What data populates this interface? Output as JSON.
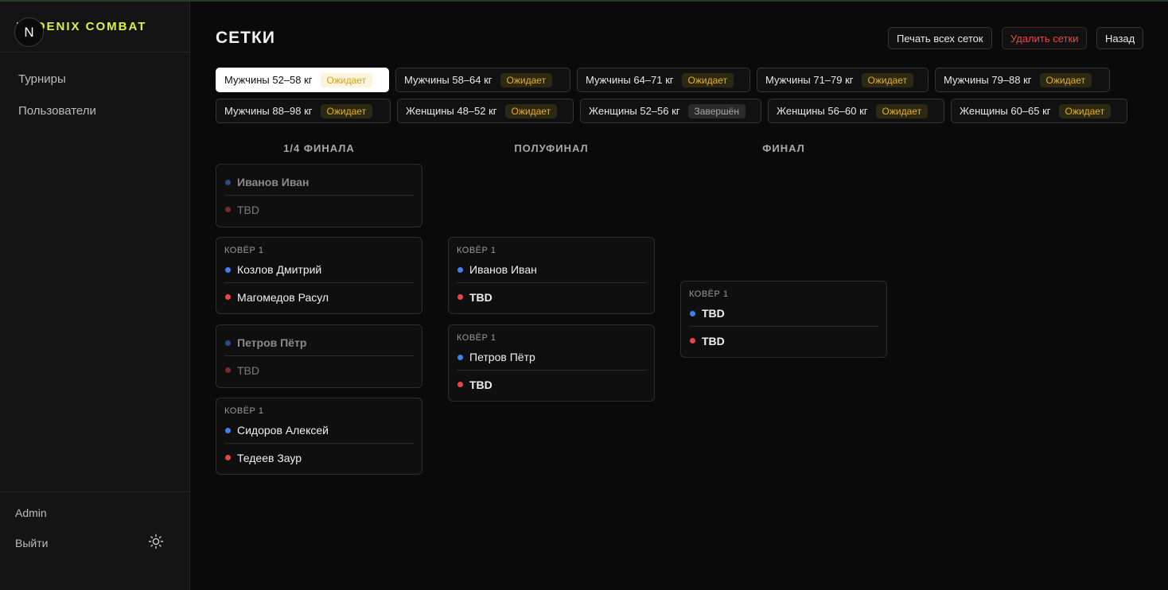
{
  "brand": {
    "name": "PHOENIX COMBAT",
    "badge_letter": "N"
  },
  "sidebar": {
    "items": [
      {
        "label": "Турниры"
      },
      {
        "label": "Пользователи"
      }
    ],
    "user": "Admin",
    "logout": "Выйти"
  },
  "header": {
    "title": "СЕТКИ",
    "print_all": "Печать всех сеток",
    "delete": "Удалить сетки",
    "back": "Назад"
  },
  "tabs": [
    {
      "label": "Мужчины 52–58 кг",
      "status": "Ожидает"
    },
    {
      "label": "Мужчины 58–64 кг",
      "status": "Ожидает"
    },
    {
      "label": "Мужчины 64–71 кг",
      "status": "Ожидает"
    },
    {
      "label": "Мужчины 71–79 кг",
      "status": "Ожидает"
    },
    {
      "label": "Мужчины 79–88 кг",
      "status": "Ожидает"
    },
    {
      "label": "Мужчины 88–98 кг",
      "status": "Ожидает"
    },
    {
      "label": "Женщины 48–52 кг",
      "status": "Ожидает"
    },
    {
      "label": "Женщины 52–56 кг",
      "status": "Завершён"
    },
    {
      "label": "Женщины 56–60 кг",
      "status": "Ожидает"
    },
    {
      "label": "Женщины 60–65 кг",
      "status": "Ожидает"
    }
  ],
  "rounds": [
    {
      "title": "1/4 ФИНАЛА"
    },
    {
      "title": "ПОЛУФИНАЛ"
    },
    {
      "title": "ФИНАЛ"
    }
  ],
  "matches": {
    "qf1": {
      "blue": "Иванов Иван",
      "red": "TBD"
    },
    "qf2": {
      "mat": "КОВЁР 1",
      "blue": "Козлов Дмитрий",
      "red": "Магомедов Расул"
    },
    "qf3": {
      "blue": "Петров Пётр",
      "red": "TBD"
    },
    "qf4": {
      "mat": "КОВЁР 1",
      "blue": "Сидоров Алексей",
      "red": "Тедеев Заур"
    },
    "sf1": {
      "mat": "КОВЁР 1",
      "blue": "Иванов Иван",
      "red": "TBD"
    },
    "sf2": {
      "mat": "КОВЁР 1",
      "blue": "Петров Пётр",
      "red": "TBD"
    },
    "f1": {
      "mat": "КОВЁР 1",
      "blue": "TBD",
      "red": "TBD"
    }
  },
  "colors": {
    "accent": "#d8f542",
    "blue_corner": "#3b82f6",
    "red_corner": "#ef4444",
    "pending": "#e8b020"
  },
  "icons": {
    "theme_toggle": "sun-icon"
  }
}
